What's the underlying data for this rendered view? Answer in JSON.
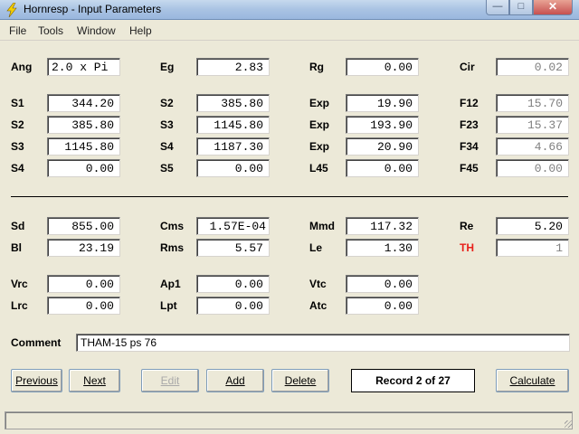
{
  "window": {
    "title": "Hornresp - Input Parameters",
    "icon": "lightning-bolt-icon"
  },
  "menu": [
    "File",
    "Tools",
    "Window",
    "Help"
  ],
  "fields": {
    "Ang": "2.0 x Pi",
    "Eg": "2.83",
    "Rg": "0.00",
    "Cir": "0.02",
    "S1": "344.20",
    "S2a": "385.80",
    "Exp1": "19.90",
    "F12": "15.70",
    "S2": "385.80",
    "S3a": "1145.80",
    "Exp2": "193.90",
    "F23": "15.37",
    "S3": "1145.80",
    "S4a": "1187.30",
    "Exp3": "20.90",
    "F34": "4.66",
    "S4": "0.00",
    "S5": "0.00",
    "L45": "0.00",
    "F45": "0.00",
    "Sd": "855.00",
    "Cms": "1.57E-04",
    "Mmd": "117.32",
    "Re": "5.20",
    "Bl": "23.19",
    "Rms": "5.57",
    "Le": "1.30",
    "TH": "1",
    "Vrc": "0.00",
    "Ap1": "0.00",
    "Vtc": "0.00",
    "Lrc": "0.00",
    "Lpt": "0.00",
    "Atc": "0.00"
  },
  "labels": {
    "Ang": "Ang",
    "Eg": "Eg",
    "Rg": "Rg",
    "Cir": "Cir",
    "S1": "S1",
    "S2": "S2",
    "S3": "S3",
    "S4": "S4",
    "S5": "S5",
    "Exp": "Exp",
    "F12": "F12",
    "F23": "F23",
    "F34": "F34",
    "F45": "F45",
    "L45": "L45",
    "Sd": "Sd",
    "Cms": "Cms",
    "Mmd": "Mmd",
    "Re": "Re",
    "Bl": "Bl",
    "Rms": "Rms",
    "Le": "Le",
    "TH": "TH",
    "Vrc": "Vrc",
    "Ap1": "Ap1",
    "Vtc": "Vtc",
    "Lrc": "Lrc",
    "Lpt": "Lpt",
    "Atc": "Atc",
    "Comment": "Comment"
  },
  "comment": "THAM-15 ps 76",
  "buttons": {
    "previous": "Previous",
    "next": "Next",
    "edit": "Edit",
    "add": "Add",
    "delete": "Delete",
    "calculate": "Calculate"
  },
  "record": "Record 2 of 27",
  "colors": {
    "th_label": "#e8201a",
    "title_bar": "#a9c3e3"
  }
}
